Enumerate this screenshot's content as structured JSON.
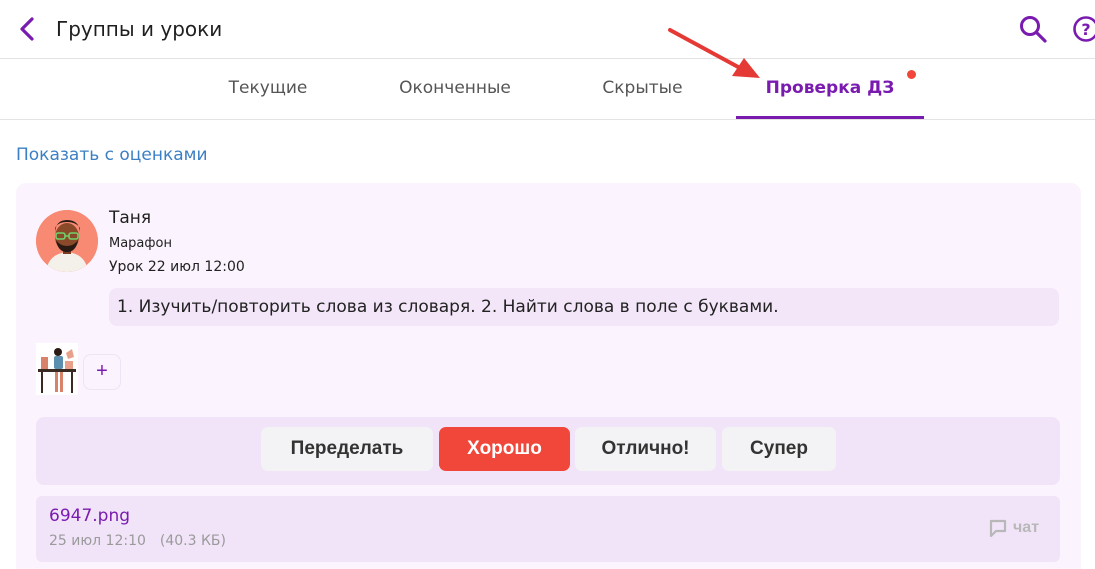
{
  "header": {
    "title": "Группы и уроки",
    "icons": [
      "chevron-left-icon",
      "search-icon",
      "help-icon"
    ],
    "accent_color": "#7a1bb0"
  },
  "tabs": [
    {
      "label": "Текущие",
      "active": false
    },
    {
      "label": "Оконченные",
      "active": false
    },
    {
      "label": "Скрытые",
      "active": false
    },
    {
      "label": "Проверка ДЗ",
      "active": true,
      "has_notification_dot": true
    }
  ],
  "filter": {
    "show_grades_link": "Показать с оценками"
  },
  "submission": {
    "student_name": "Таня",
    "course": "Марафон",
    "lesson": "Урок 22 июл 12:00",
    "task": "1. Изучить/повторить слова из словаря. 2. Найти слова в поле с буквами.",
    "add_attachment_label": "+",
    "grades": [
      {
        "label": "Переделать",
        "selected": false
      },
      {
        "label": "Хорошо",
        "selected": true
      },
      {
        "label": "Отлично!",
        "selected": false
      },
      {
        "label": "Супер",
        "selected": false
      }
    ],
    "file": {
      "name": "6947.png",
      "date": "25 июл 12:10",
      "size": "(40.3 КБ)",
      "chat_label": "чат"
    }
  },
  "colors": {
    "selected_grade": "#f0473a",
    "card_background": "#fbf3fd",
    "link_blue": "#3b7fc4",
    "annotation_arrow": "#e53935"
  }
}
